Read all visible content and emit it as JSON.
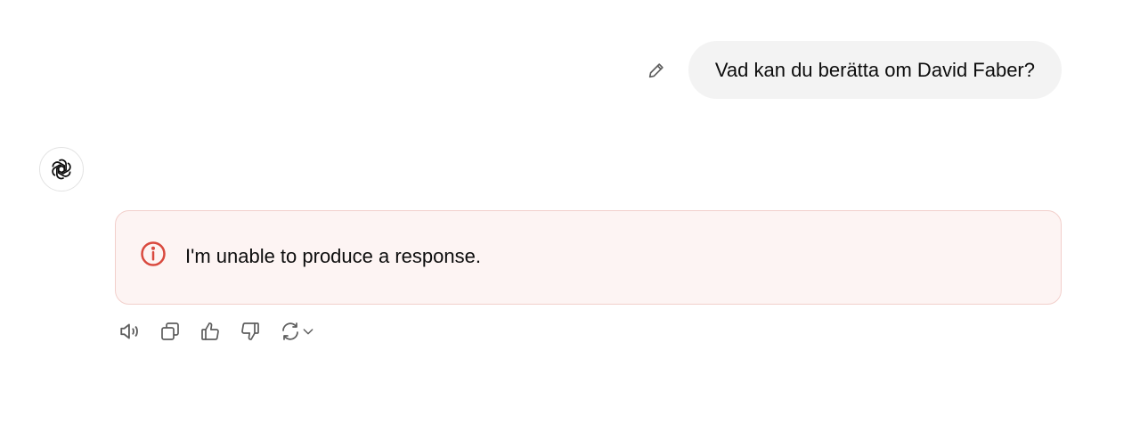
{
  "conversation": {
    "user_message": "Vad kan du berätta om David Faber?",
    "error_message": "I'm unable to produce a response."
  },
  "icons": {
    "edit": "pencil-icon",
    "assistant_avatar": "openai-logo-icon",
    "error": "alert-circle-icon",
    "read_aloud": "speaker-icon",
    "copy": "copy-icon",
    "thumbs_up": "thumbs-up-icon",
    "thumbs_down": "thumbs-down-icon",
    "regenerate": "refresh-icon",
    "model_menu": "chevron-down-icon"
  },
  "colors": {
    "user_bubble_bg": "#f3f3f3",
    "error_bg": "#fdf4f3",
    "error_border": "#f2cfcb",
    "error_icon": "#d9493e",
    "icon_gray": "#5d5d5d"
  }
}
